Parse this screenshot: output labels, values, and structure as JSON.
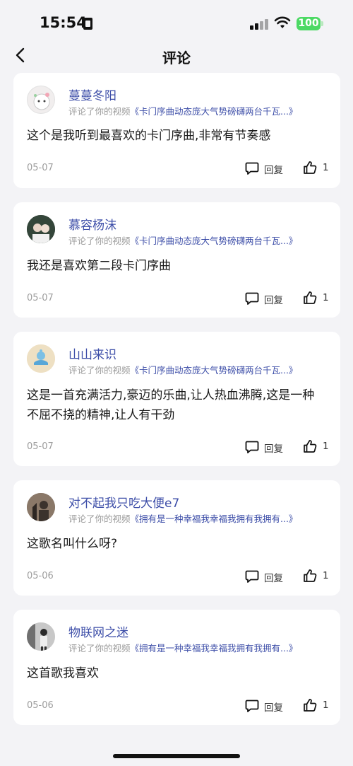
{
  "status_bar": {
    "time": "15:54",
    "battery": "100",
    "battery_color": "#4cd964"
  },
  "nav": {
    "title": "评论"
  },
  "colors": {
    "accent": "#3d4ea8"
  },
  "comments": [
    {
      "user": "蔓蔓冬阳",
      "prefix": "评论了你的视频",
      "video": "《卡门序曲动态庞大气势磅礴两台千瓦...》",
      "text": "这个是我听到最喜欢的卡门序曲,非常有节奏感",
      "date": "05-07",
      "reply": "回复",
      "likes": "1"
    },
    {
      "user": "慕容杨沫",
      "prefix": "评论了你的视频",
      "video": "《卡门序曲动态庞大气势磅礴两台千瓦...》",
      "text": "我还是喜欢第二段卡门序曲",
      "date": "05-07",
      "reply": "回复",
      "likes": "1"
    },
    {
      "user": "山山来识",
      "prefix": "评论了你的视频",
      "video": "《卡门序曲动态庞大气势磅礴两台千瓦...》",
      "text": "这是一首充满活力,豪迈的乐曲,让人热血沸腾,这是一种不屈不挠的精神,让人有干劲",
      "date": "05-07",
      "reply": "回复",
      "likes": "1"
    },
    {
      "user": "对不起我只吃大便e7",
      "prefix": "评论了你的视频",
      "video": "《拥有是一种幸福我幸福我拥有我拥有...》",
      "text": "这歌名叫什么呀?",
      "date": "05-06",
      "reply": "回复",
      "likes": "1"
    },
    {
      "user": "物联网之迷",
      "prefix": "评论了你的视频",
      "video": "《拥有是一种幸福我幸福我拥有我拥有...》",
      "text": "这首歌我喜欢",
      "date": "05-06",
      "reply": "回复",
      "likes": "1"
    }
  ]
}
